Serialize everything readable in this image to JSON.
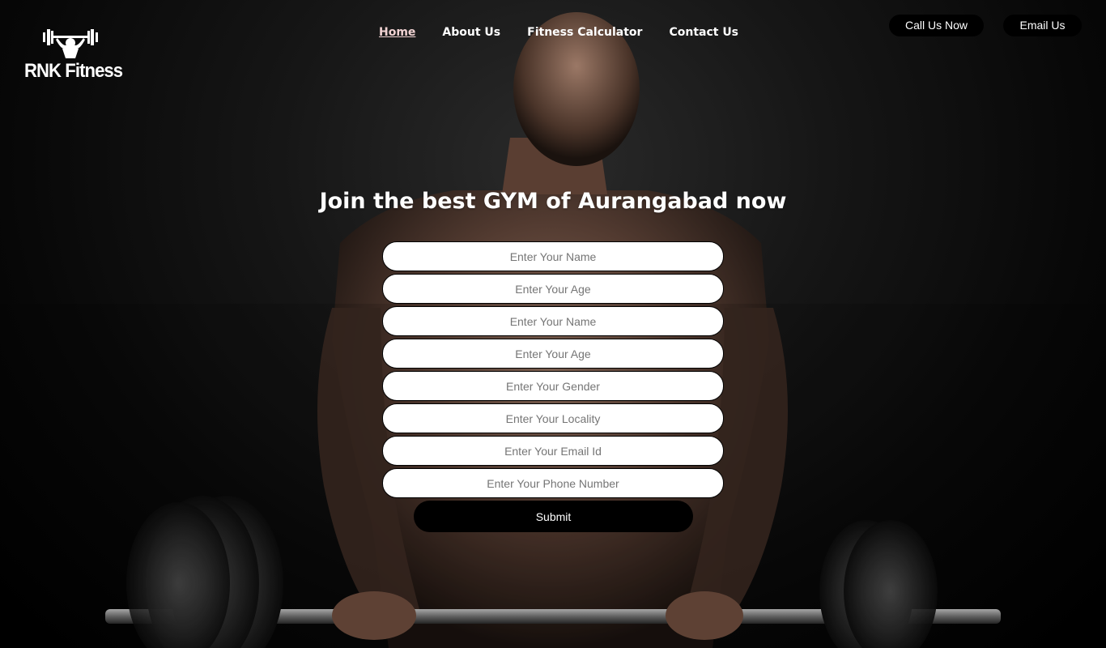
{
  "brand": {
    "name": "RNK Fitness",
    "logo_icon": "weightlifter-icon"
  },
  "nav": {
    "items": [
      {
        "label": "Home",
        "active": true
      },
      {
        "label": "About Us",
        "active": false
      },
      {
        "label": "Fitness Calculator",
        "active": false
      },
      {
        "label": "Contact Us",
        "active": false
      }
    ]
  },
  "header_actions": {
    "call_label": "Call Us Now",
    "email_label": "Email Us"
  },
  "hero": {
    "headline": "Join the best GYM of Aurangabad now",
    "background_image": "man-lifting-barbell"
  },
  "form": {
    "fields": [
      {
        "placeholder": "Enter Your Name"
      },
      {
        "placeholder": "Enter Your Age"
      },
      {
        "placeholder": "Enter Your Name"
      },
      {
        "placeholder": "Enter Your Age"
      },
      {
        "placeholder": "Enter Your Gender"
      },
      {
        "placeholder": "Enter Your Locality"
      },
      {
        "placeholder": "Enter Your Email Id"
      },
      {
        "placeholder": "Enter Your Phone Number"
      }
    ],
    "submit_label": "Submit"
  },
  "colors": {
    "background": "#000000",
    "text": "#ffffff",
    "active_nav": "#f1d3d3",
    "input_bg": "#ffffff"
  }
}
